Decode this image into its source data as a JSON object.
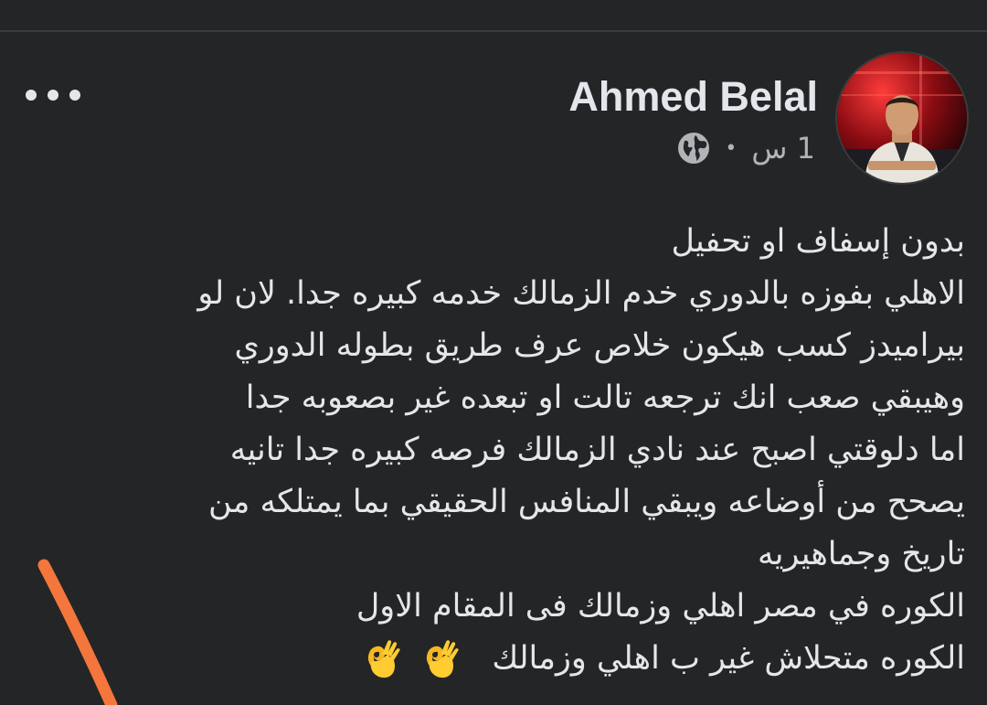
{
  "post": {
    "author": "Ahmed Belal",
    "timestamp": "1 س",
    "separator": "•",
    "icons": {
      "more": "more-options-icon",
      "audience": "globe-icon",
      "reaction": "ok-hand-emoji"
    },
    "lines": [
      "بدون إسفاف او تحفيل",
      "الاهلي بفوزه بالدوري  خدم الزمالك خدمه كبيره جدا. لان لو",
      "بيراميدز كسب  هيكون خلاص  عرف طريق بطوله الدوري",
      "وهيبقي صعب انك ترجعه تالت  او تبعده غير بصعوبه جدا",
      "اما دلوقتي اصبح عند نادي الزمالك فرصه كبيره جدا  تانيه",
      "يصحح من أوضاعه ويبقي المنافس الحقيقي  بما يمتلكه من",
      "تاريخ وجماهيريه",
      "الكوره  في مصر اهلي وزمالك فى المقام  الاول",
      "الكوره متحلاش غير ب اهلي وزمالك"
    ]
  },
  "colors": {
    "background": "#242526",
    "text": "#e4e6eb",
    "secondary_text": "#b0b3b8",
    "annotation_stroke": "#f4763c"
  }
}
